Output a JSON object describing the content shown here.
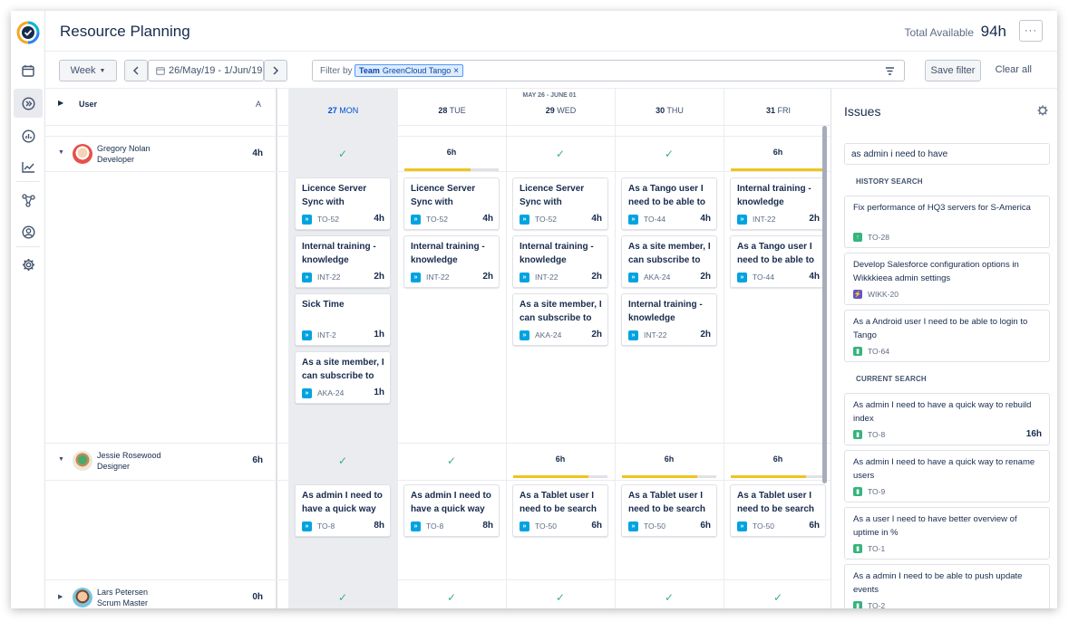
{
  "app": {
    "title": "Resource Planning",
    "total_label": "Total Available",
    "total_value": "94h",
    "more": "···"
  },
  "toolbar": {
    "view": "Week",
    "date_range": "26/May/19 - 1/Jun/19",
    "filter_label": "Filter by",
    "chip_prefix": "Team",
    "chip_value": "GreenCloud Tango",
    "save_filter": "Save filter",
    "clear_all": "Clear all"
  },
  "grid": {
    "user_header": "User",
    "sort_header": "A",
    "range_label": "MAY 26 - JUNE 01",
    "days": [
      {
        "num": "27",
        "dow": "MON"
      },
      {
        "num": "28",
        "dow": "TUE"
      },
      {
        "num": "29",
        "dow": "WED"
      },
      {
        "num": "30",
        "dow": "THU"
      },
      {
        "num": "31",
        "dow": "FRI"
      }
    ],
    "users": [
      {
        "name": "Gregory Nolan",
        "role": "Developer",
        "hours": "4h",
        "status": [
          "✓",
          "6h",
          "✓",
          "✓",
          "6h"
        ],
        "load": [
          null,
          0.7,
          null,
          null,
          1.0
        ],
        "cards": [
          [
            {
              "title": "Licence Server Sync with",
              "key": "TO-52",
              "hours": "4h"
            },
            {
              "title": "Internal training - knowledge",
              "key": "INT-22",
              "hours": "2h"
            },
            {
              "title": "Sick Time",
              "key": "INT-2",
              "hours": "1h"
            },
            {
              "title": "As a site member, I can subscribe to",
              "key": "AKA-24",
              "hours": "1h"
            }
          ],
          [
            {
              "title": "Licence Server Sync with",
              "key": "TO-52",
              "hours": "4h"
            },
            {
              "title": "Internal training - knowledge",
              "key": "INT-22",
              "hours": "2h"
            }
          ],
          [
            {
              "title": "Licence Server Sync with",
              "key": "TO-52",
              "hours": "4h"
            },
            {
              "title": "Internal training - knowledge",
              "key": "INT-22",
              "hours": "2h"
            },
            {
              "title": "As a site member, I can subscribe to",
              "key": "AKA-24",
              "hours": "2h"
            }
          ],
          [
            {
              "title": "As a Tango user I need to be able to",
              "key": "TO-44",
              "hours": "4h"
            },
            {
              "title": "As a site member, I can subscribe to",
              "key": "AKA-24",
              "hours": "2h"
            },
            {
              "title": "Internal training - knowledge",
              "key": "INT-22",
              "hours": "2h"
            }
          ],
          [
            {
              "title": "Internal training - knowledge",
              "key": "INT-22",
              "hours": "2h"
            },
            {
              "title": "As a Tango user I need to be able to",
              "key": "TO-44",
              "hours": "4h"
            }
          ]
        ]
      },
      {
        "name": "Jessie Rosewood",
        "role": "Designer",
        "hours": "6h",
        "status": [
          "✓",
          "✓",
          "6h",
          "6h",
          "6h"
        ],
        "load": [
          null,
          null,
          0.8,
          0.8,
          0.8
        ],
        "cards": [
          [
            {
              "title": "As admin I need to have a quick way",
              "key": "TO-8",
              "hours": "8h"
            }
          ],
          [
            {
              "title": "As admin I need to have a quick way",
              "key": "TO-8",
              "hours": "8h"
            }
          ],
          [
            {
              "title": "As a Tablet user I need to be search",
              "key": "TO-50",
              "hours": "6h"
            }
          ],
          [
            {
              "title": "As a Tablet user I need to be search",
              "key": "TO-50",
              "hours": "6h"
            }
          ],
          [
            {
              "title": "As a Tablet user I need to be search",
              "key": "TO-50",
              "hours": "6h"
            }
          ]
        ]
      },
      {
        "name": "Lars Petersen",
        "role": "Scrum Master",
        "hours": "0h",
        "status": [
          "✓",
          "✓",
          "✓",
          "✓",
          "✓"
        ],
        "load": [
          null,
          null,
          null,
          null,
          null
        ],
        "cards": [
          [],
          [],
          [],
          [],
          []
        ]
      }
    ]
  },
  "issues_panel": {
    "title": "Issues",
    "search_value": "as admin i need to have",
    "history_label": "HISTORY SEARCH",
    "current_label": "CURRENT SEARCH",
    "history": [
      {
        "title": "Fix performance of HQ3 servers for S-America",
        "key": "TO-28",
        "type": "improvement",
        "color": "#36b37e"
      },
      {
        "title": "Develop Salesforce configuration options in Wikkkieea admin settings",
        "key": "WIKK-20",
        "type": "epic",
        "color": "#6554c0"
      },
      {
        "title": "As a Android user I need to be able to login to Tango",
        "key": "TO-64",
        "type": "story",
        "color": "#36b37e"
      }
    ],
    "current": [
      {
        "title": "As admin I need to have a quick way to rebuild index",
        "key": "TO-8",
        "hours": "16h",
        "type": "story",
        "color": "#36b37e"
      },
      {
        "title": "As admin I need to have a quick way to rename users",
        "key": "TO-9",
        "hours": "",
        "type": "story",
        "color": "#36b37e"
      },
      {
        "title": "As a user I need to have better overview of uptime in %",
        "key": "TO-1",
        "hours": "",
        "type": "story",
        "color": "#36b37e"
      },
      {
        "title": "As a admin I need to be able to push update events",
        "key": "TO-2",
        "hours": "",
        "type": "story",
        "color": "#36b37e"
      }
    ]
  },
  "colors": {
    "accent": "#0052cc",
    "load_bar": "#f0c41b",
    "task_icon": "#00a3e0",
    "check": "#36b37e"
  }
}
